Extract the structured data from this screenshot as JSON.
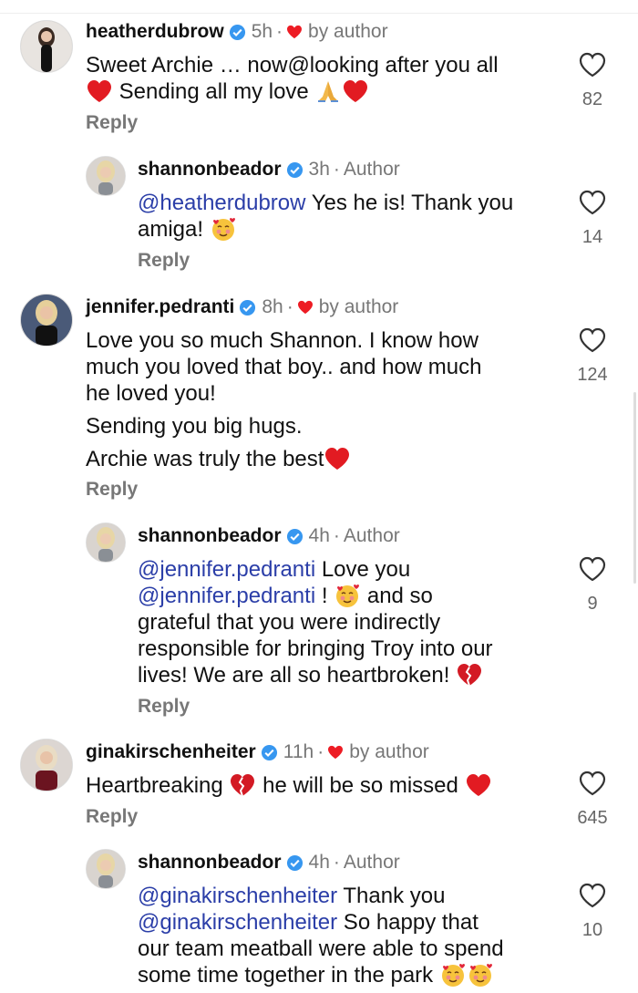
{
  "threads": [
    {
      "username": "heatherdubrow",
      "time": "5h",
      "badge_text": "by author",
      "is_author": false,
      "body": [
        [
          {
            "t": "Sweet Archie … now@looking after you all"
          }
        ],
        [
          {
            "emoji": "red-heart"
          },
          {
            "t": " Sending all my love "
          },
          {
            "emoji": "folded-hands"
          },
          {
            "emoji": "red-heart"
          }
        ]
      ],
      "likes": "82",
      "reply": "Reply"
    },
    {
      "username": "shannonbeador",
      "time": "3h",
      "badge_text": "Author",
      "is_author": true,
      "body": [
        [
          {
            "mention": "@heatherdubrow"
          },
          {
            "t": " Yes he is! Thank you"
          }
        ],
        [
          {
            "t": "amiga! "
          },
          {
            "emoji": "smiling-hearts"
          }
        ]
      ],
      "likes": "14",
      "reply": "Reply"
    },
    {
      "username": "jennifer.pedranti",
      "time": "8h",
      "badge_text": "by author",
      "is_author": false,
      "paragraphs": [
        [
          "Love you so much Shannon. I know how",
          "much you loved that boy.. and how much",
          "he loved you!"
        ],
        [
          "Sending you big hugs."
        ],
        [
          "Archie was truly the best"
        ]
      ],
      "likes": "124",
      "reply": "Reply"
    },
    {
      "username": "shannonbeador",
      "time": "4h",
      "badge_text": "Author",
      "is_author": true,
      "body": [
        [
          {
            "mention": "@jennifer.pedranti"
          },
          {
            "t": " Love you"
          }
        ],
        [
          {
            "mention": "@jennifer.pedranti"
          },
          {
            "t": " ! "
          },
          {
            "emoji": "smiling-hearts"
          },
          {
            "t": " and so"
          }
        ],
        [
          {
            "t": "grateful that you were indirectly"
          }
        ],
        [
          {
            "t": "responsible for bringing Troy into our"
          }
        ],
        [
          {
            "t": "lives! We are all so heartbroken! "
          },
          {
            "emoji": "broken-heart"
          }
        ]
      ],
      "likes": "9",
      "reply": "Reply"
    },
    {
      "username": "ginakirschenheiter",
      "time": "11h",
      "badge_text": "by author",
      "is_author": false,
      "body": [
        [
          {
            "t": "Heartbreaking "
          },
          {
            "emoji": "broken-heart"
          },
          {
            "t": " he will be so missed "
          },
          {
            "emoji": "red-heart"
          }
        ]
      ],
      "likes": "645",
      "reply": "Reply"
    },
    {
      "username": "shannonbeador",
      "time": "4h",
      "badge_text": "Author",
      "is_author": true,
      "body": [
        [
          {
            "mention": "@ginakirschenheiter"
          },
          {
            "t": " Thank you"
          }
        ],
        [
          {
            "mention": "@ginakirschenheiter"
          },
          {
            "t": "  So happy that"
          }
        ],
        [
          {
            "t": "our team meatball were able to spend"
          }
        ],
        [
          {
            "t": "some time together in the park "
          },
          {
            "emoji": "smiling-hearts"
          },
          {
            "emoji": "smiling-hearts"
          }
        ]
      ],
      "likes": "10",
      "reply": ""
    }
  ],
  "separator": "·",
  "colors": {
    "verified": "#3797f0",
    "heart_badge": "#ed1c24",
    "mention": "#2b3ea8",
    "muted": "#777777"
  },
  "icons": {
    "like": "heart-outline-icon",
    "verified": "verified-badge-icon"
  }
}
